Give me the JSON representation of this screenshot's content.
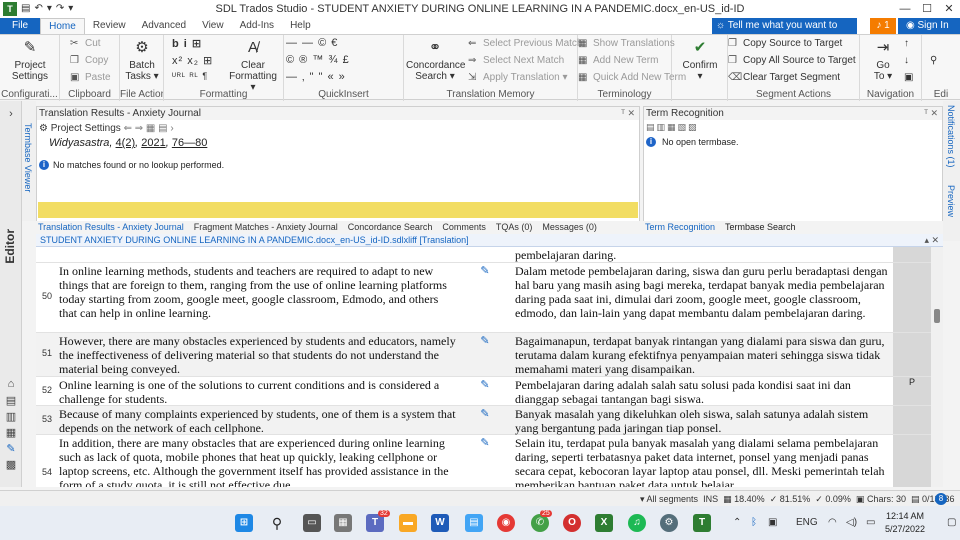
{
  "window": {
    "title": "SDL Trados Studio - STUDENT ANXIETY DURING ONLINE LEARNING IN A PANDEMIC.docx_en-US_id-ID"
  },
  "ribbon_tabs": [
    "File",
    "Home",
    "Review",
    "Advanced",
    "View",
    "Add-Ins",
    "Help"
  ],
  "tell_me": "Tell me what you want to do...",
  "notifications_count": "1",
  "sign_in": "Sign In",
  "ribbon": {
    "configuration": {
      "label": "Configurati...",
      "project_settings": [
        "Project",
        "Settings"
      ]
    },
    "clipboard": {
      "label": "Clipboard",
      "cut": "Cut",
      "copy": "Copy",
      "paste": "Paste"
    },
    "file_actions": {
      "label": "File Actions",
      "batch_tasks": [
        "Batch",
        "Tasks ▾"
      ]
    },
    "formatting": {
      "label": "Formatting",
      "clear_formatting": [
        "Clear",
        "Formatting ▾"
      ],
      "row1": "b  i  ⊞",
      "row2": "x²  x₂  ⊞",
      "row3": "ᵁᴿᴸ  ᴿᴸ  ¶"
    },
    "quickinsert": {
      "label": "QuickInsert",
      "row1": "—  —  ©  €",
      "row2": "© ® ™ ¾ £",
      "row3": "— ‚ \" \" « »"
    },
    "translation_memory": {
      "label": "Translation Memory",
      "concordance_search": [
        "Concordance",
        "Search ▾"
      ],
      "prev_match": "Select Previous Match",
      "next_match": "Select Next Match",
      "apply_translation": "Apply Translation ▾"
    },
    "terminology": {
      "label": "Terminology",
      "show_translations": "Show Translations",
      "add_new_term": "Add New Term",
      "quick_add": "Quick Add New Term"
    },
    "confirm": {
      "label": "Confirm"
    },
    "segment_actions": {
      "label": "Segment Actions",
      "copy_source": "Copy Source to Target",
      "copy_all_source": "Copy All Source to Target",
      "clear_target": "Clear Target Segment"
    },
    "navigation": {
      "label": "Navigation",
      "go_to": [
        "Go",
        "To ▾"
      ]
    },
    "editing": {
      "label": "Edi"
    }
  },
  "left_strip": {
    "editor_label": "Editor",
    "termbase_viewer": "Termbase Viewer"
  },
  "right_strip": {
    "notifications": "Notifications (1)",
    "preview": "Preview"
  },
  "translation_results": {
    "title": "Translation Results - Anxiety Journal",
    "project_settings": "Project Settings",
    "citation_journal": "Widyasastra",
    "citation_volume": "4(2)",
    "citation_year": "2021",
    "citation_pages": "76—80",
    "message": "No matches found or no lookup performed."
  },
  "bottom_tabs": [
    "Translation Results - Anxiety Journal",
    "Fragment Matches - Anxiety Journal",
    "Concordance Search",
    "Comments",
    "TQAs (0)",
    "Messages (0)"
  ],
  "term_recognition": {
    "title": "Term Recognition",
    "message": "No open termbase."
  },
  "term_tabs": [
    "Term Recognition",
    "Termbase Search"
  ],
  "editor_tab": "STUDENT ANXIETY DURING ONLINE LEARNING IN A PANDEMIC.docx_en-US_id-ID.sdlxliff [Translation]",
  "segments": [
    {
      "num": "",
      "source": "",
      "target": "pembelajaran daring.",
      "status": ""
    },
    {
      "num": "50",
      "source": "In online learning methods, students and teachers are required to adapt to new things that are foreign to them, ranging from the use of online learning platforms today starting from zoom, google meet, google classroom, Edmodo, and others that can help in online learning.",
      "target": "Dalam metode pembelajaran daring, siswa dan guru perlu beradaptasi dengan hal baru yang masih asing bagi mereka, terdapat banyak media pembelajaran daring pada saat ini, dimulai dari zoom, google meet, google classroom, edmodo, dan lain-lain yang dapat membantu dalam pembelajaran daring.",
      "status": "✎"
    },
    {
      "num": "51",
      "source": "However, there are many obstacles experienced by students and educators, namely the ineffectiveness of delivering material so that students do not understand the material being conveyed.",
      "target": "Bagaimanapun, terdapat banyak rintangan yang dialami para siswa dan guru, terutama dalam kurang efektifnya penyampaian materi sehingga siswa tidak memahami materi yang disampaikan.",
      "status": "✎"
    },
    {
      "num": "52",
      "source": "Online learning is one of the solutions to current conditions and is considered a challenge for students.",
      "target": "Pembelajaran daring adalah salah satu solusi pada kondisi saat ini dan dianggap sebagai tantangan bagi siswa.",
      "status": "✎",
      "lock": "P"
    },
    {
      "num": "53",
      "source": "Because of many complaints experienced by students, one of them is a system that depends on the network of each cellphone.",
      "target": "Banyak masalah yang dikeluhkan oleh siswa, salah satunya adalah sistem yang bergantung pada jaringan tiap ponsel.",
      "status": "✎"
    },
    {
      "num": "54",
      "source": "In addition, there are many obstacles that are experienced during online learning such as lack of quota, mobile phones that heat up quickly, leaking cellphone or laptop screens, etc. Although the government itself has provided assistance in the form of a study quota, it is still not effective due",
      "target": "Selain itu, terdapat pula banyak masalah yang dialami selama pembelajaran daring, seperti terbatasnya paket data internet, ponsel yang menjadi panas secara cepat, kebocoran layar laptop atau ponsel, dll. Meski pemerintah telah memberikan bantuan paket data untuk belajar,",
      "status": "✎"
    }
  ],
  "status_bar": {
    "filter": "All segments",
    "mode": "INS",
    "pct1": "18.40%",
    "pct2": "81.51%",
    "pct3": "0.09%",
    "chars": "Chars: 30",
    "position": "0/13136",
    "badge": "8"
  },
  "taskbar": {
    "language": "ENG",
    "time": "12:14 AM",
    "date": "5/27/2022",
    "badge_teams": "32",
    "badge_chrome": "25"
  },
  "colors": {
    "accent": "#1565c0",
    "yellow_bar": "#f2dd63",
    "notification": "#f57c00"
  }
}
